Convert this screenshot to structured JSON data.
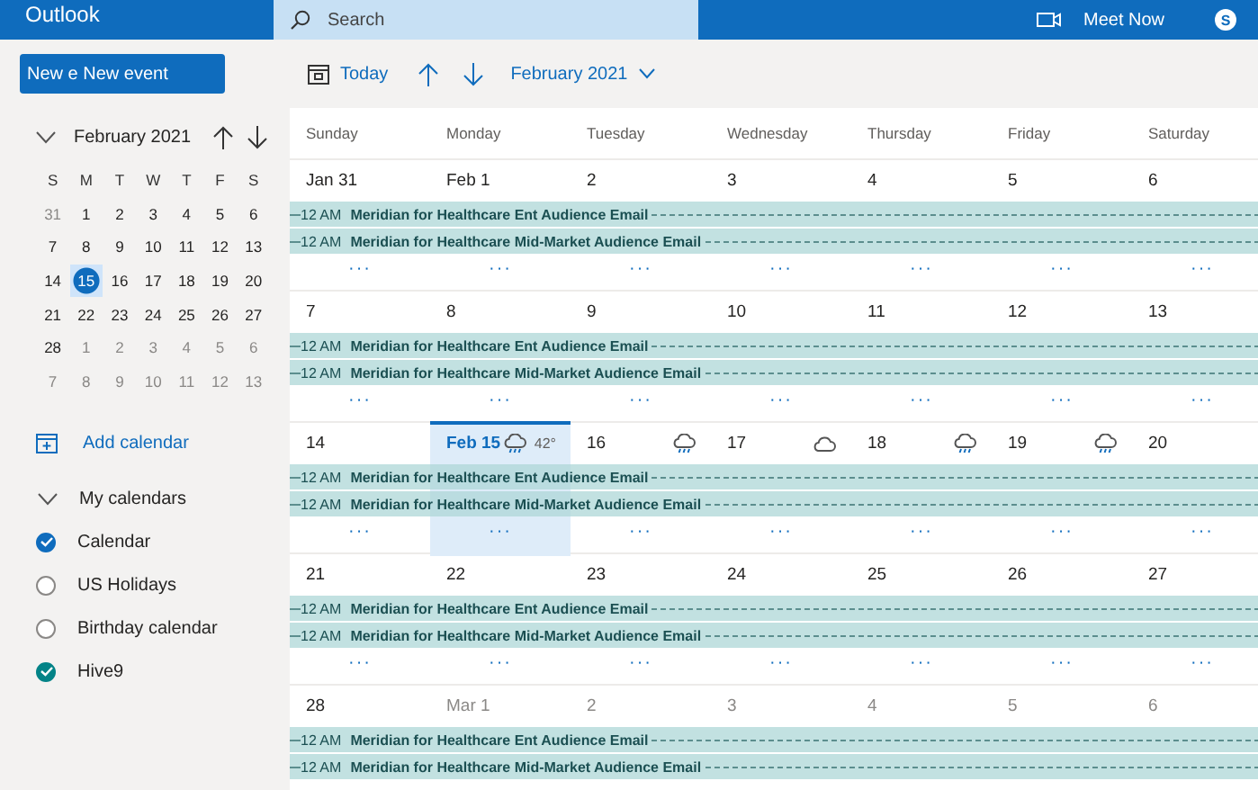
{
  "app": {
    "name": "Outlook",
    "search": {
      "placeholder": "Search"
    },
    "meet_now": "Meet Now",
    "avatar": "S"
  },
  "new_event": "New e New event",
  "toolbar": {
    "today": "Today",
    "period": "February 2021"
  },
  "mini_calendar": {
    "title": "February 2021",
    "weekdays": [
      "S",
      "M",
      "T",
      "W",
      "T",
      "F",
      "S"
    ],
    "weeks": [
      [
        {
          "d": "31",
          "other": true,
          "selected": false
        },
        {
          "d": "1",
          "other": false,
          "selected": false
        },
        {
          "d": "2",
          "other": false,
          "selected": false
        },
        {
          "d": "3",
          "other": false,
          "selected": false
        },
        {
          "d": "4",
          "other": false,
          "selected": false
        },
        {
          "d": "5",
          "other": false,
          "selected": false
        },
        {
          "d": "6",
          "other": false,
          "selected": false
        }
      ],
      [
        {
          "d": "7",
          "other": false,
          "selected": false
        },
        {
          "d": "8",
          "other": false,
          "selected": false
        },
        {
          "d": "9",
          "other": false,
          "selected": false
        },
        {
          "d": "10",
          "other": false,
          "selected": false
        },
        {
          "d": "11",
          "other": false,
          "selected": false
        },
        {
          "d": "12",
          "other": false,
          "selected": false
        },
        {
          "d": "13",
          "other": false,
          "selected": false
        }
      ],
      [
        {
          "d": "14",
          "other": false,
          "selected": false
        },
        {
          "d": "15",
          "other": false,
          "selected": true
        },
        {
          "d": "16",
          "other": false,
          "selected": false
        },
        {
          "d": "17",
          "other": false,
          "selected": false
        },
        {
          "d": "18",
          "other": false,
          "selected": false
        },
        {
          "d": "19",
          "other": false,
          "selected": false
        },
        {
          "d": "20",
          "other": false,
          "selected": false
        }
      ],
      [
        {
          "d": "21",
          "other": false,
          "selected": false
        },
        {
          "d": "22",
          "other": false,
          "selected": false
        },
        {
          "d": "23",
          "other": false,
          "selected": false
        },
        {
          "d": "24",
          "other": false,
          "selected": false
        },
        {
          "d": "25",
          "other": false,
          "selected": false
        },
        {
          "d": "26",
          "other": false,
          "selected": false
        },
        {
          "d": "27",
          "other": false,
          "selected": false
        }
      ],
      [
        {
          "d": "28",
          "other": false,
          "selected": false
        },
        {
          "d": "1",
          "other": true,
          "selected": false
        },
        {
          "d": "2",
          "other": true,
          "selected": false
        },
        {
          "d": "3",
          "other": true,
          "selected": false
        },
        {
          "d": "4",
          "other": true,
          "selected": false
        },
        {
          "d": "5",
          "other": true,
          "selected": false
        },
        {
          "d": "6",
          "other": true,
          "selected": false
        }
      ],
      [
        {
          "d": "7",
          "other": true,
          "selected": false
        },
        {
          "d": "8",
          "other": true,
          "selected": false
        },
        {
          "d": "9",
          "other": true,
          "selected": false
        },
        {
          "d": "10",
          "other": true,
          "selected": false
        },
        {
          "d": "11",
          "other": true,
          "selected": false
        },
        {
          "d": "12",
          "other": true,
          "selected": false
        },
        {
          "d": "13",
          "other": true,
          "selected": false
        }
      ]
    ]
  },
  "add_calendar": "Add calendar",
  "my_calendars": {
    "title": "My calendars",
    "expanded": true,
    "items": [
      {
        "name": "Calendar",
        "checked": true,
        "color": "#0f6cbd"
      },
      {
        "name": "US Holidays",
        "checked": false
      },
      {
        "name": "Birthday calendar",
        "checked": false
      },
      {
        "name": "Hive9",
        "checked": true,
        "color": "#038387"
      }
    ]
  },
  "weekdays": [
    "Sunday",
    "Monday",
    "Tuesday",
    "Wednesday",
    "Thursday",
    "Friday",
    "Saturday"
  ],
  "weeks": [
    {
      "days": [
        {
          "label": "Jan 31",
          "other": false,
          "selected": false,
          "more": "···"
        },
        {
          "label": "Feb 1",
          "other": false,
          "selected": false,
          "more": "···"
        },
        {
          "label": "2",
          "other": false,
          "selected": false,
          "more": "···"
        },
        {
          "label": "3",
          "other": false,
          "selected": false,
          "more": "···"
        },
        {
          "label": "4",
          "other": false,
          "selected": false,
          "more": "···"
        },
        {
          "label": "5",
          "other": false,
          "selected": false,
          "more": "···"
        },
        {
          "label": "6",
          "other": false,
          "selected": false,
          "more": "···"
        }
      ],
      "events": [
        {
          "time": "12 AM",
          "title": "Meridian for Healthcare Ent Audience Email"
        },
        {
          "time": "12 AM",
          "title": "Meridian for Healthcare Mid-Market Audience Email"
        }
      ]
    },
    {
      "days": [
        {
          "label": "7",
          "other": false,
          "selected": false,
          "more": "···"
        },
        {
          "label": "8",
          "other": false,
          "selected": false,
          "more": "···"
        },
        {
          "label": "9",
          "other": false,
          "selected": false,
          "more": "···"
        },
        {
          "label": "10",
          "other": false,
          "selected": false,
          "more": "···"
        },
        {
          "label": "11",
          "other": false,
          "selected": false,
          "more": "···"
        },
        {
          "label": "12",
          "other": false,
          "selected": false,
          "more": "···"
        },
        {
          "label": "13",
          "other": false,
          "selected": false,
          "more": "···"
        }
      ],
      "events": [
        {
          "time": "12 AM",
          "title": "Meridian for Healthcare Ent Audience Email"
        },
        {
          "time": "12 AM",
          "title": "Meridian for Healthcare Mid-Market Audience Email"
        }
      ]
    },
    {
      "days": [
        {
          "label": "14",
          "other": false,
          "selected": false,
          "more": "···"
        },
        {
          "label": "Feb 15",
          "other": false,
          "selected": true,
          "weather": {
            "kind": "rain"
          },
          "temp": "42°",
          "more": "···"
        },
        {
          "label": "16",
          "other": false,
          "selected": false,
          "weather": {
            "kind": "rain"
          },
          "more": "···"
        },
        {
          "label": "17",
          "other": false,
          "selected": false,
          "weather": {
            "kind": "cloud"
          },
          "more": "···"
        },
        {
          "label": "18",
          "other": false,
          "selected": false,
          "weather": {
            "kind": "rain"
          },
          "more": "···"
        },
        {
          "label": "19",
          "other": false,
          "selected": false,
          "weather": {
            "kind": "rain"
          },
          "more": "···"
        },
        {
          "label": "20",
          "other": false,
          "selected": false,
          "more": "···"
        }
      ],
      "events": [
        {
          "time": "12 AM",
          "title": "Meridian for Healthcare Ent Audience Email"
        },
        {
          "time": "12 AM",
          "title": "Meridian for Healthcare Mid-Market Audience Email"
        }
      ]
    },
    {
      "days": [
        {
          "label": "21",
          "other": false,
          "selected": false,
          "more": "···"
        },
        {
          "label": "22",
          "other": false,
          "selected": false,
          "more": "···"
        },
        {
          "label": "23",
          "other": false,
          "selected": false,
          "more": "···"
        },
        {
          "label": "24",
          "other": false,
          "selected": false,
          "more": "···"
        },
        {
          "label": "25",
          "other": false,
          "selected": false,
          "more": "···"
        },
        {
          "label": "26",
          "other": false,
          "selected": false,
          "more": "···"
        },
        {
          "label": "27",
          "other": false,
          "selected": false,
          "more": "···"
        }
      ],
      "events": [
        {
          "time": "12 AM",
          "title": "Meridian for Healthcare Ent Audience Email"
        },
        {
          "time": "12 AM",
          "title": "Meridian for Healthcare Mid-Market Audience Email"
        }
      ]
    },
    {
      "days": [
        {
          "label": "28",
          "other": false,
          "selected": false
        },
        {
          "label": "Mar 1",
          "other": true,
          "selected": false
        },
        {
          "label": "2",
          "other": true,
          "selected": false
        },
        {
          "label": "3",
          "other": true,
          "selected": false
        },
        {
          "label": "4",
          "other": true,
          "selected": false
        },
        {
          "label": "5",
          "other": true,
          "selected": false
        },
        {
          "label": "6",
          "other": true,
          "selected": false
        }
      ],
      "events": [
        {
          "time": "12 AM",
          "title": "Meridian for Healthcare Ent Audience Email"
        },
        {
          "time": "12 AM",
          "title": "Meridian for Healthcare Mid-Market Audience Email"
        }
      ]
    }
  ]
}
